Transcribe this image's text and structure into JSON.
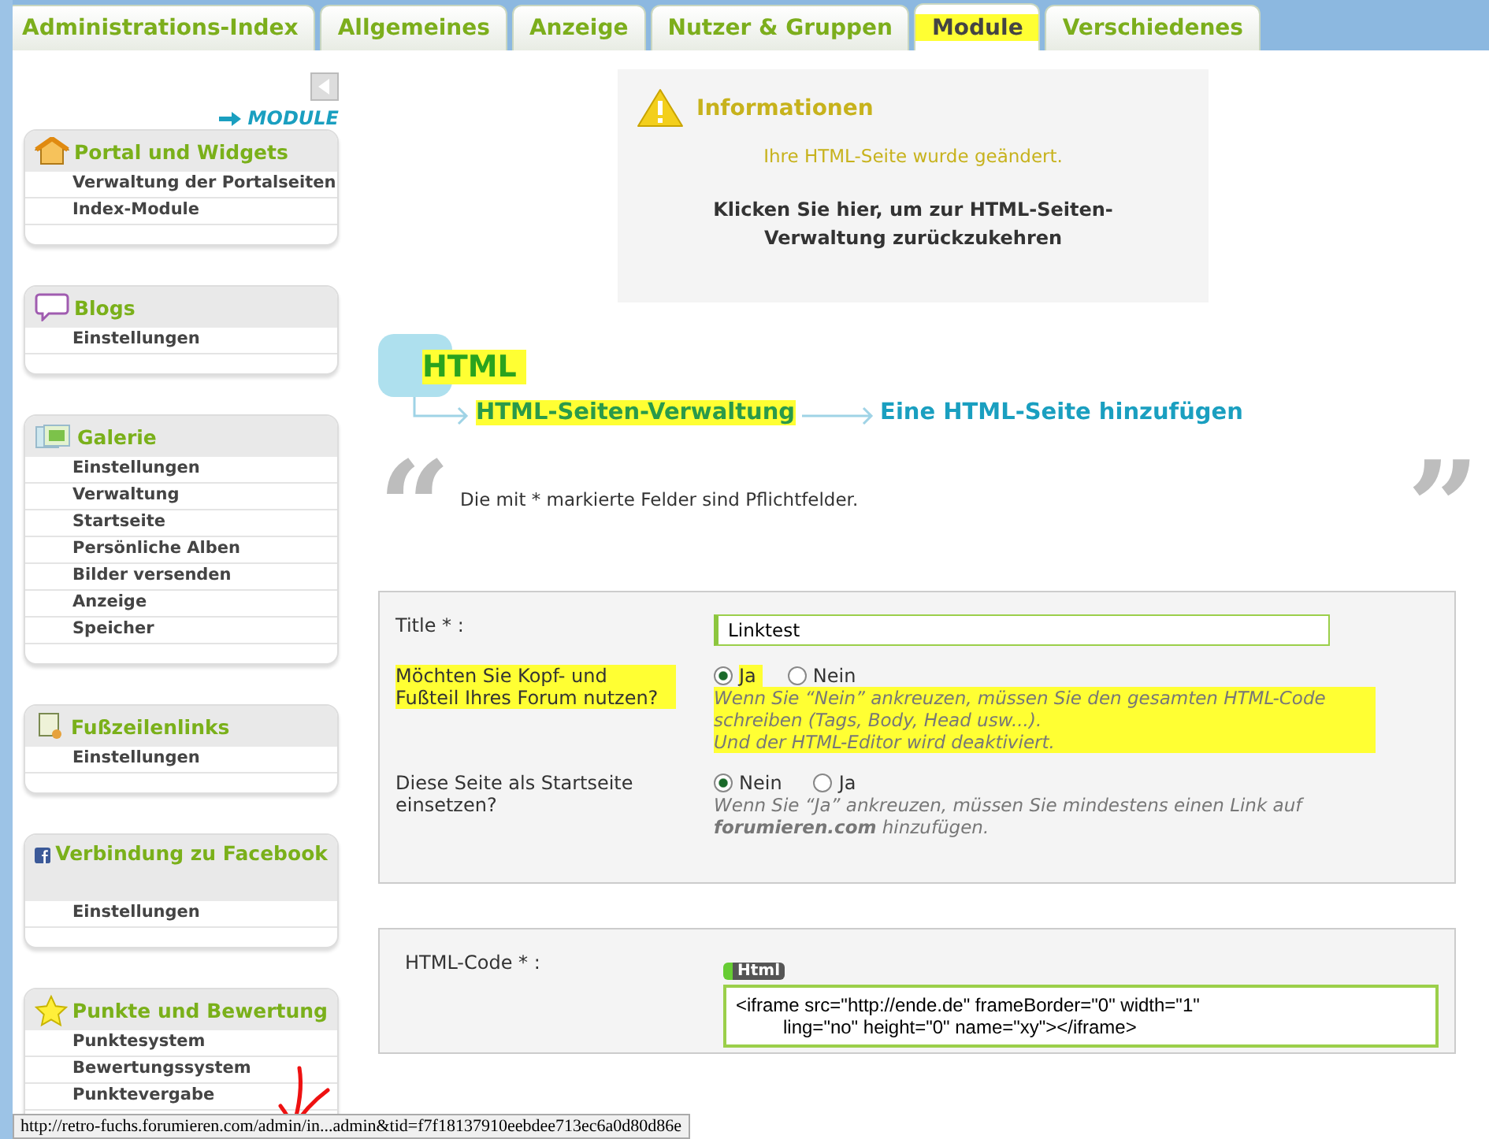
{
  "tabs": [
    {
      "label": "Administrations-Index",
      "selected": false,
      "highlighted": false
    },
    {
      "label": "Allgemeines",
      "selected": false,
      "highlighted": false
    },
    {
      "label": "Anzeige",
      "selected": false,
      "highlighted": false
    },
    {
      "label": "Nutzer & Gruppen",
      "selected": false,
      "highlighted": false
    },
    {
      "label": "Module",
      "selected": true,
      "highlighted": true
    },
    {
      "label": "Verschiedenes",
      "selected": false,
      "highlighted": false
    }
  ],
  "sidebar": {
    "heading": "MODULE",
    "sections": [
      {
        "kind": "house",
        "title": "Portal und Widgets",
        "items": [
          "Verwaltung der Portalseiten",
          "Index-Module"
        ]
      },
      {
        "kind": "speech",
        "title": "Blogs",
        "items": [
          "Einstellungen"
        ]
      },
      {
        "kind": "photos",
        "title": "Galerie",
        "items": [
          "Einstellungen",
          "Verwaltung",
          "Startseite",
          "Persönliche Alben",
          "Bilder versenden",
          "Anzeige",
          "Speicher"
        ]
      },
      {
        "kind": "scroll",
        "title": "Fußzeilenlinks",
        "items": [
          "Einstellungen"
        ]
      },
      {
        "kind": "facebook",
        "title": "Verbindung zu Facebook",
        "items": [
          "Einstellungen"
        ]
      },
      {
        "kind": "star",
        "title": "Punkte und Bewertung",
        "items": [
          "Punktesystem",
          "Bewertungssystem",
          "Punktevergabe"
        ]
      }
    ]
  },
  "info": {
    "title": "Informationen",
    "message": "Ihre HTML-Seite wurde geändert.",
    "link": "Klicken Sie hier, um zur HTML-Seiten-Verwaltung zurückzukehren"
  },
  "breadcrumb": {
    "root": {
      "label": "HTML",
      "highlighted": true
    },
    "steps": [
      {
        "label": "HTML-Seiten-Verwaltung",
        "highlighted": true
      },
      {
        "label": "Eine HTML-Seite hinzufügen",
        "highlighted": false
      }
    ]
  },
  "quote_open": "“",
  "quote_close": "”",
  "required_note": "Die mit * markierte Felder sind Pflichtfelder.",
  "form": {
    "rows": [
      {
        "kind": "text",
        "label": "Title * :",
        "highlighted": false,
        "value": "Linktest"
      },
      {
        "kind": "radio",
        "label": "Möchten Sie Kopf- und Fußteil Ihres Forum nutzen?",
        "highlighted": true,
        "options": [
          {
            "label": "Ja",
            "selected": true,
            "highlighted": true
          },
          {
            "label": "Nein",
            "selected": false,
            "highlighted": false
          }
        ],
        "hint": "Wenn Sie “Nein” ankreuzen, müssen Sie den gesamten HTML-Code schreiben (Tags, Body, Head usw...).\nUnd der HTML-Editor wird deaktiviert.",
        "hint_highlighted": true
      },
      {
        "kind": "radio",
        "label": "Diese Seite als Startseite einsetzen?",
        "highlighted": false,
        "options": [
          {
            "label": "Nein",
            "selected": true,
            "highlighted": false
          },
          {
            "label": "Ja",
            "selected": false,
            "highlighted": false
          }
        ],
        "hint": "Wenn Sie “Ja” ankreuzen, müssen Sie mindestens einen Link auf **forumieren.com** hinzufügen.",
        "hint_highlighted": false
      }
    ]
  },
  "code_form": {
    "label": "HTML-Code * :",
    "badge": "Html",
    "lines": [
      "<iframe src=\"http://ende.de\" frameBorder=\"0\" width=\"1\"",
      "ling=\"no\" height=\"0\" name=\"xy\"></iframe>"
    ]
  },
  "status_bar": "http://retro-fuchs.forumieren.com/admin/in...admin&tid=f7f18137910eebdee713ec6a0d80d86e"
}
